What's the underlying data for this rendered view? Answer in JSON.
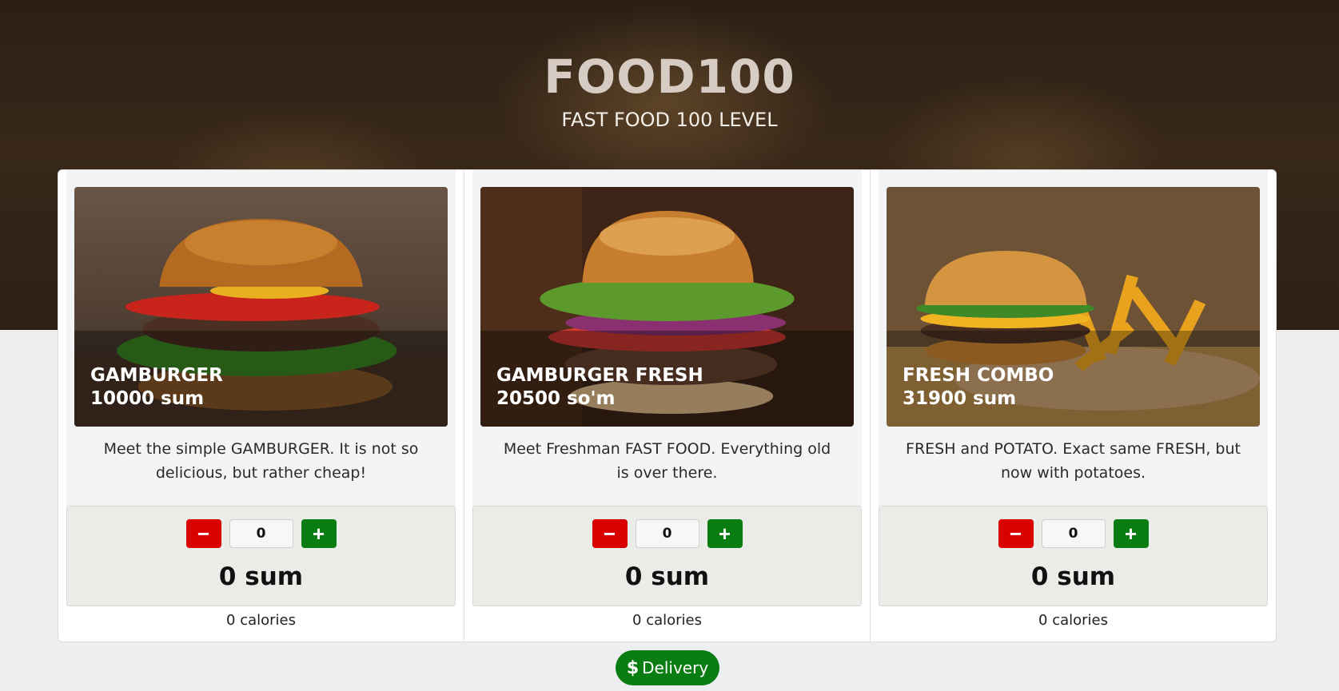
{
  "header": {
    "title": "FOOD100",
    "subtitle": "FAST FOOD 100 LEVEL"
  },
  "products": [
    {
      "name": "GAMBURGER",
      "price": "10000 sum",
      "description": "Meet the simple GAMBURGER. It is not so delicious, but rather cheap!",
      "quantity": "0",
      "total": "0 sum",
      "calories": "0 calories"
    },
    {
      "name": "GAMBURGER FRESH",
      "price": "20500 so'm",
      "description": "Meet Freshman FAST FOOD. Everything old is over there.",
      "quantity": "0",
      "total": "0 sum",
      "calories": "0 calories"
    },
    {
      "name": "FRESH COMBO",
      "price": "31900 sum",
      "description": "FRESH and POTATO. Exact same FRESH, but now with potatoes.",
      "quantity": "0",
      "total": "0 sum",
      "calories": "0 calories"
    }
  ],
  "controls": {
    "minus_symbol": "−",
    "plus_symbol": "+"
  },
  "delivery": {
    "label": "Delivery",
    "icon": "dollar-icon",
    "icon_glyph": "$"
  },
  "colors": {
    "minus": "#d90000",
    "plus": "#0a7d12",
    "delivery": "#0a7d12"
  }
}
